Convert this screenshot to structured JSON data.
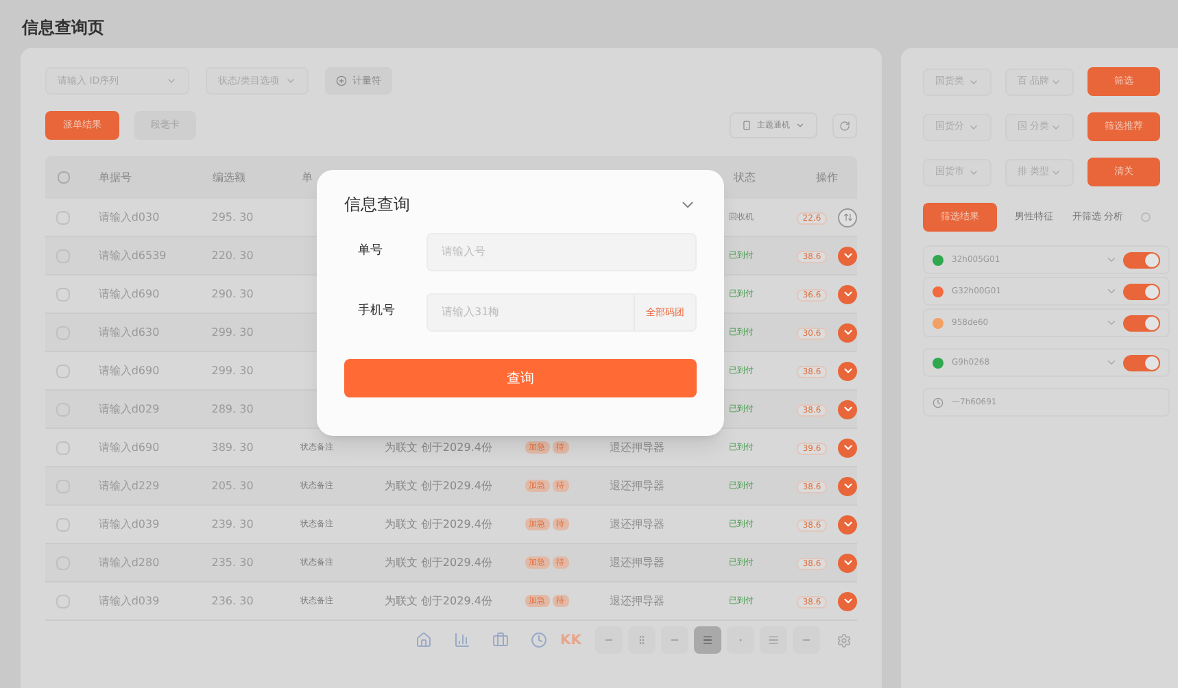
{
  "page_title": "信息查询页",
  "filters": {
    "id_select": "请输入 ID序列",
    "status_select": "状态/类目选项",
    "meter_button": "计量符"
  },
  "actions": {
    "primary": "派单结果",
    "secondary": "段毫卡",
    "theme_select": "主题通机"
  },
  "table": {
    "all_checked": false,
    "columns": [
      "单据号",
      "编选额",
      "单",
      "状态",
      "操作"
    ],
    "rows": [
      {
        "checked": false,
        "id": "请输入d030",
        "amount": "295. 30",
        "status": {
          "text": "回收机",
          "active": false
        },
        "badge": "22.6",
        "done": false
      },
      {
        "checked": false,
        "id": "请输入d6539",
        "amount": "220. 30",
        "status": {
          "text": "已到付",
          "active": true
        },
        "badge": "38.6",
        "done": true
      },
      {
        "checked": false,
        "id": "请输入d690",
        "amount": "290. 30",
        "status": {
          "text": "已到付",
          "active": true
        },
        "badge": "36.6",
        "done": true
      },
      {
        "checked": false,
        "id": "请输入d630",
        "amount": "299. 30",
        "status": {
          "text": "已到付",
          "active": true
        },
        "badge": "30.6",
        "done": true
      },
      {
        "checked": false,
        "id": "请输入d690",
        "amount": "299. 30",
        "status": {
          "text": "已到付",
          "active": true
        },
        "badge": "38.6",
        "done": true
      },
      {
        "checked": false,
        "id": "请输入d029",
        "amount": "289. 30",
        "status": {
          "text": "已到付",
          "active": true
        },
        "badge": "38.6",
        "done": true
      },
      {
        "checked": false,
        "id": "请输入d690",
        "amount": "389. 30",
        "note": "状态备注",
        "desc": "为联文 创于2029.4份",
        "tags": [
          "加急",
          "待"
        ],
        "channel": "退还押导器",
        "status": {
          "text": "已到付",
          "active": true
        },
        "badge": "39.6",
        "done": true
      },
      {
        "checked": false,
        "id": "请输入d229",
        "amount": "205. 30",
        "note": "状态备注",
        "desc": "为联文 创于2029.4份",
        "tags": [
          "加急",
          "待"
        ],
        "channel": "退还押导器",
        "status": {
          "text": "已到付",
          "active": true
        },
        "badge": "38.6",
        "done": true
      },
      {
        "checked": false,
        "id": "请输入d039",
        "amount": "239. 30",
        "note": "状态备注",
        "desc": "为联文 创于2029.4份",
        "tags": [
          "加急",
          "待"
        ],
        "channel": "退还押导器",
        "status": {
          "text": "已到付",
          "active": true
        },
        "badge": "38.6",
        "done": true
      },
      {
        "checked": false,
        "id": "请输入d280",
        "amount": "235. 30",
        "note": "状态备注",
        "desc": "为联文 创于2029.4份",
        "tags": [
          "加急",
          "待"
        ],
        "channel": "退还押导器",
        "status": {
          "text": "已到付",
          "active": true
        },
        "badge": "38.6",
        "done": true
      },
      {
        "checked": false,
        "id": "请输入d039",
        "amount": "236. 30",
        "note": "状态备注",
        "desc": "为联文 创于2029.4份",
        "tags": [
          "加急",
          "待"
        ],
        "channel": "退还押导器",
        "status": {
          "text": "已到付",
          "active": true
        },
        "badge": "38.6",
        "done": true
      }
    ]
  },
  "toolbar": {
    "logo": "KK",
    "buttons": [
      {
        "selected": false
      },
      {
        "selected": false
      },
      {
        "selected": false
      },
      {
        "selected": true
      },
      {
        "selected": false
      },
      {
        "selected": false
      },
      {
        "selected": false
      }
    ]
  },
  "side": {
    "filter_rows": [
      {
        "select_a": "国货类",
        "select_b": "百 品牌",
        "button": "筛选"
      },
      {
        "select_a": "国货分",
        "select_b": "国 分类",
        "button": "筛选推荐"
      },
      {
        "select_a": "国货市",
        "select_b": "排 类型",
        "button": "清关"
      }
    ],
    "tabs": [
      {
        "label": "筛选结果",
        "selected": true
      },
      {
        "label": "男性特征",
        "selected": false
      },
      {
        "label": "开筛选 分析",
        "selected": false
      }
    ],
    "items": [
      {
        "code": "32h005G01",
        "color": "#2fa84f",
        "on": true
      },
      {
        "code": "G32h00G01",
        "color": "#f26a3d",
        "on": true
      },
      {
        "code": "958de60",
        "color": "#f3a064",
        "on": true
      },
      {
        "code": "G9h0268",
        "color": "#2fa84f",
        "on": true
      }
    ],
    "time_row": "一7h60691"
  },
  "dialog": {
    "title": "信息查询",
    "fields": [
      {
        "label": "单号",
        "placeholder": "请输入号"
      },
      {
        "label": "手机号",
        "placeholder": "请输入31梅",
        "suffix": "全部码团"
      }
    ],
    "submit": "查询"
  }
}
